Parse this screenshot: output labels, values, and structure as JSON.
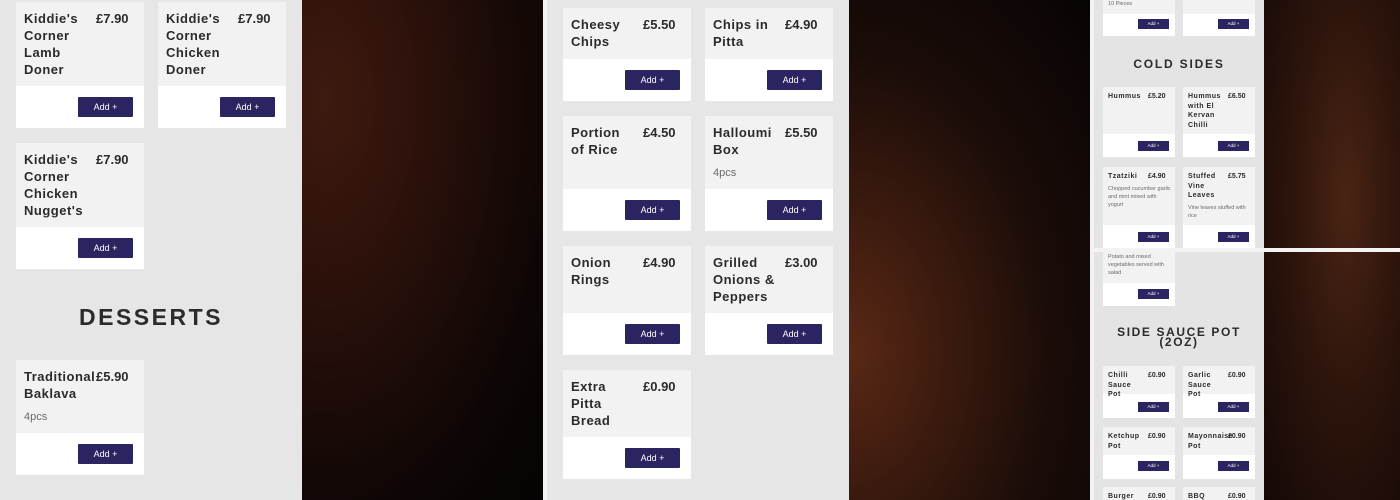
{
  "add_label": "Add +",
  "colors": {
    "button": "#2a2560",
    "panel": "#e6e6e6",
    "card": "#f2f2f2"
  },
  "col1": {
    "items": [
      {
        "name": "Kiddie's Corner Lamb Doner",
        "price": "£7.90"
      },
      {
        "name": "Kiddie's Corner Chicken Doner",
        "price": "£7.90"
      },
      {
        "name": "Kiddie's Corner Chicken Nugget's",
        "price": "£7.90"
      }
    ],
    "desserts_heading": "DESSERTS",
    "desserts": [
      {
        "name": "Traditional Baklava",
        "price": "£5.90",
        "desc": "4pcs"
      }
    ]
  },
  "col2": {
    "items": [
      {
        "name": "Cheesy Chips",
        "price": "£5.50",
        "desc": ""
      },
      {
        "name": "Chips in Pitta",
        "price": "£4.90",
        "desc": ""
      },
      {
        "name": "Portion of Rice",
        "price": "£4.50",
        "desc": ""
      },
      {
        "name": "Halloumi Box",
        "price": "£5.50",
        "desc": "4pcs"
      },
      {
        "name": "Onion Rings",
        "price": "£4.90",
        "desc": ""
      },
      {
        "name": "Grilled Onions & Peppers",
        "price": "£3.00",
        "desc": ""
      },
      {
        "name": "Extra Pitta Bread",
        "price": "£0.90",
        "desc": ""
      }
    ]
  },
  "col3": {
    "top_partial_desc": "10 Pieces",
    "cold_sides_heading": "COLD SIDES",
    "cold_sides": [
      {
        "name": "Hummus",
        "price": "£5.20",
        "desc": ""
      },
      {
        "name": "Hummus with El Kervan Chilli",
        "price": "£6.50",
        "desc": ""
      },
      {
        "name": "Tzatziki",
        "price": "£4.90",
        "desc": "Chopped cucumber garlic and mint mixed with yogurt"
      },
      {
        "name": "Stuffed Vine Leaves",
        "price": "£5.75",
        "desc": "Vine leaves stuffed with rice"
      }
    ],
    "partial_desc": "Potato and mixed vegetables served with salad",
    "sauce_heading": "SIDE SAUCE POT (2OZ)",
    "sauces": [
      {
        "name": "Chilli Sauce Pot",
        "price": "£0.90"
      },
      {
        "name": "Garlic Sauce Pot",
        "price": "£0.90"
      },
      {
        "name": "Ketchup Pot",
        "price": "£0.90"
      },
      {
        "name": "Mayonnaise Pot",
        "price": "£0.90"
      },
      {
        "name": "Burger",
        "price": "£0.90"
      },
      {
        "name": "BBQ",
        "price": "£0.90"
      }
    ]
  }
}
